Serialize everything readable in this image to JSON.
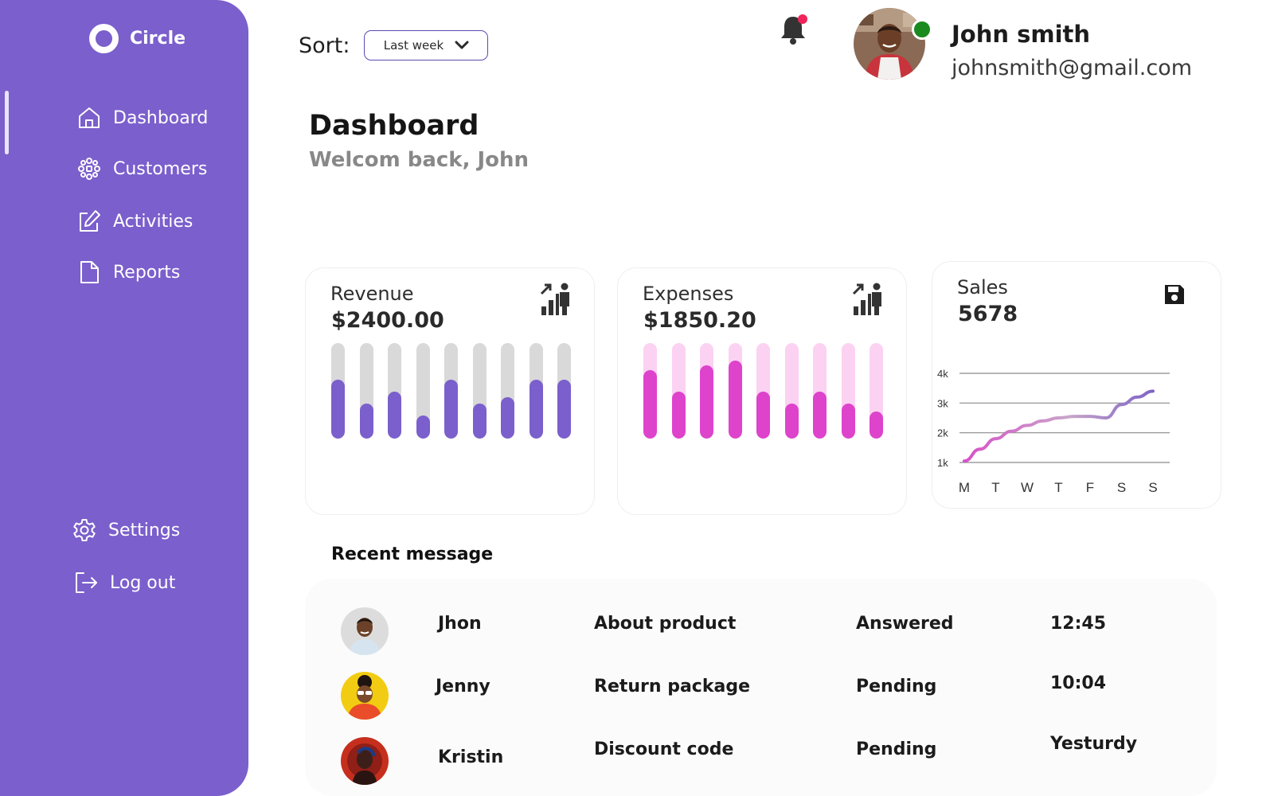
{
  "app": {
    "name": "Circle"
  },
  "sidebar": {
    "items": [
      {
        "label": "Dashboard",
        "icon": "home-icon"
      },
      {
        "label": "Customers",
        "icon": "customers-icon"
      },
      {
        "label": "Activities",
        "icon": "edit-icon"
      },
      {
        "label": "Reports",
        "icon": "file-icon"
      },
      {
        "label": "Settings",
        "icon": "gear-icon"
      },
      {
        "label": "Log out",
        "icon": "logout-icon"
      }
    ]
  },
  "topbar": {
    "sort_label": "Sort:",
    "sort_value": "Last week",
    "user_name": "John smith",
    "user_email": "johnsmith@gmail.com"
  },
  "header": {
    "title": "Dashboard",
    "subtitle": "Welcom back, John"
  },
  "cards": {
    "revenue": {
      "title": "Revenue",
      "value": "$2400.00",
      "icon": "growth-icon",
      "bar_levels": [
        0.62,
        0.37,
        0.49,
        0.24,
        0.62,
        0.37,
        0.43,
        0.62,
        0.62
      ],
      "track_color": "#d9d9d9",
      "fill_color": "#7b5fcc"
    },
    "expenses": {
      "title": "Expenses",
      "value": "$1850.20",
      "icon": "growth-icon",
      "bar_levels": [
        0.72,
        0.49,
        0.77,
        0.82,
        0.49,
        0.37,
        0.49,
        0.37,
        0.28
      ],
      "track_color": "#fcd2f2",
      "fill_color": "#de43cc"
    },
    "sales": {
      "title": "Sales",
      "value": "5678",
      "icon": "save-icon"
    }
  },
  "chart_data": {
    "type": "line",
    "categories": [
      "M",
      "T",
      "W",
      "T",
      "F",
      "S",
      "S"
    ],
    "y_ticks": [
      "1k",
      "2k",
      "3k",
      "4k"
    ],
    "ylim": [
      1,
      4
    ],
    "x": [
      0,
      0.5,
      1,
      1.5,
      2,
      2.5,
      3,
      3.5,
      4,
      4.5,
      5,
      5.5,
      6
    ],
    "values": [
      1.05,
      1.45,
      1.8,
      2.05,
      2.25,
      2.4,
      2.5,
      2.55,
      2.55,
      2.5,
      2.95,
      3.2,
      3.4
    ],
    "grid": true,
    "line_start_color": "#d850c8",
    "line_end_color": "#7e63c6"
  },
  "messages": {
    "title": "Recent message",
    "rows": [
      {
        "name": "Jhon",
        "subject": "About product",
        "status": "Answered",
        "time": "12:45"
      },
      {
        "name": "Jenny",
        "subject": "Return package",
        "status": "Pending",
        "time": "10:04"
      },
      {
        "name": "Kristin",
        "subject": "Discount code",
        "status": "Pending",
        "time": "Yesturdy"
      }
    ]
  }
}
